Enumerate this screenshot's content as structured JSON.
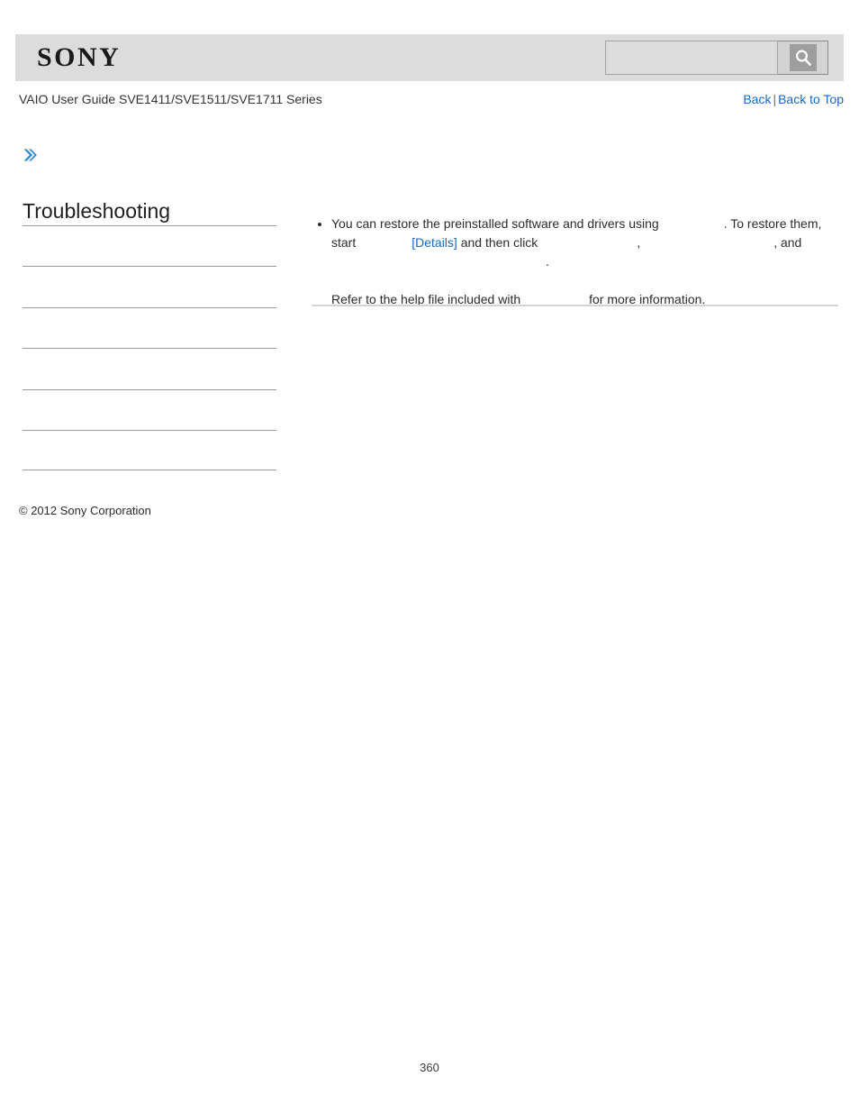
{
  "header": {
    "logo_text": "SONY",
    "search": {
      "value": "",
      "placeholder": "",
      "icon": "search-icon"
    }
  },
  "title_bar": {
    "guide_title": "VAIO User Guide SVE1411/SVE1511/SVE1711 Series",
    "back_label": "Back",
    "separator": "|",
    "back_to_top_label": "Back to Top"
  },
  "sidebar": {
    "chevron_icon": "double-chevron-right-icon",
    "heading": "Troubleshooting",
    "items": [
      {
        "label": ""
      },
      {
        "label": ""
      },
      {
        "label": ""
      },
      {
        "label": ""
      },
      {
        "label": ""
      },
      {
        "label": ""
      }
    ],
    "copyright": "© 2012 Sony Corporation"
  },
  "content": {
    "bullet": {
      "text_1": "You can restore the preinstalled software and drivers using",
      "blank_1": "",
      "text_2": ". To restore them, start",
      "blank_2": "",
      "details_link": "[Details]",
      "text_3": "and then click",
      "blank_3": "",
      "comma_1": ",",
      "blank_4": "",
      "comma_2": ", and",
      "blank_5": "",
      "period_1": ".",
      "text_4": "Refer to the help file included with",
      "blank_6": "",
      "text_5": "for more information."
    }
  },
  "footer": {
    "page_number": "360"
  },
  "colors": {
    "header_band": "#dcdcdc",
    "link_blue": "#1569c7",
    "chevron_blue": "#2b85c7",
    "rule_gray": "#9a9a9a",
    "content_rule": "#d4d4d4"
  }
}
